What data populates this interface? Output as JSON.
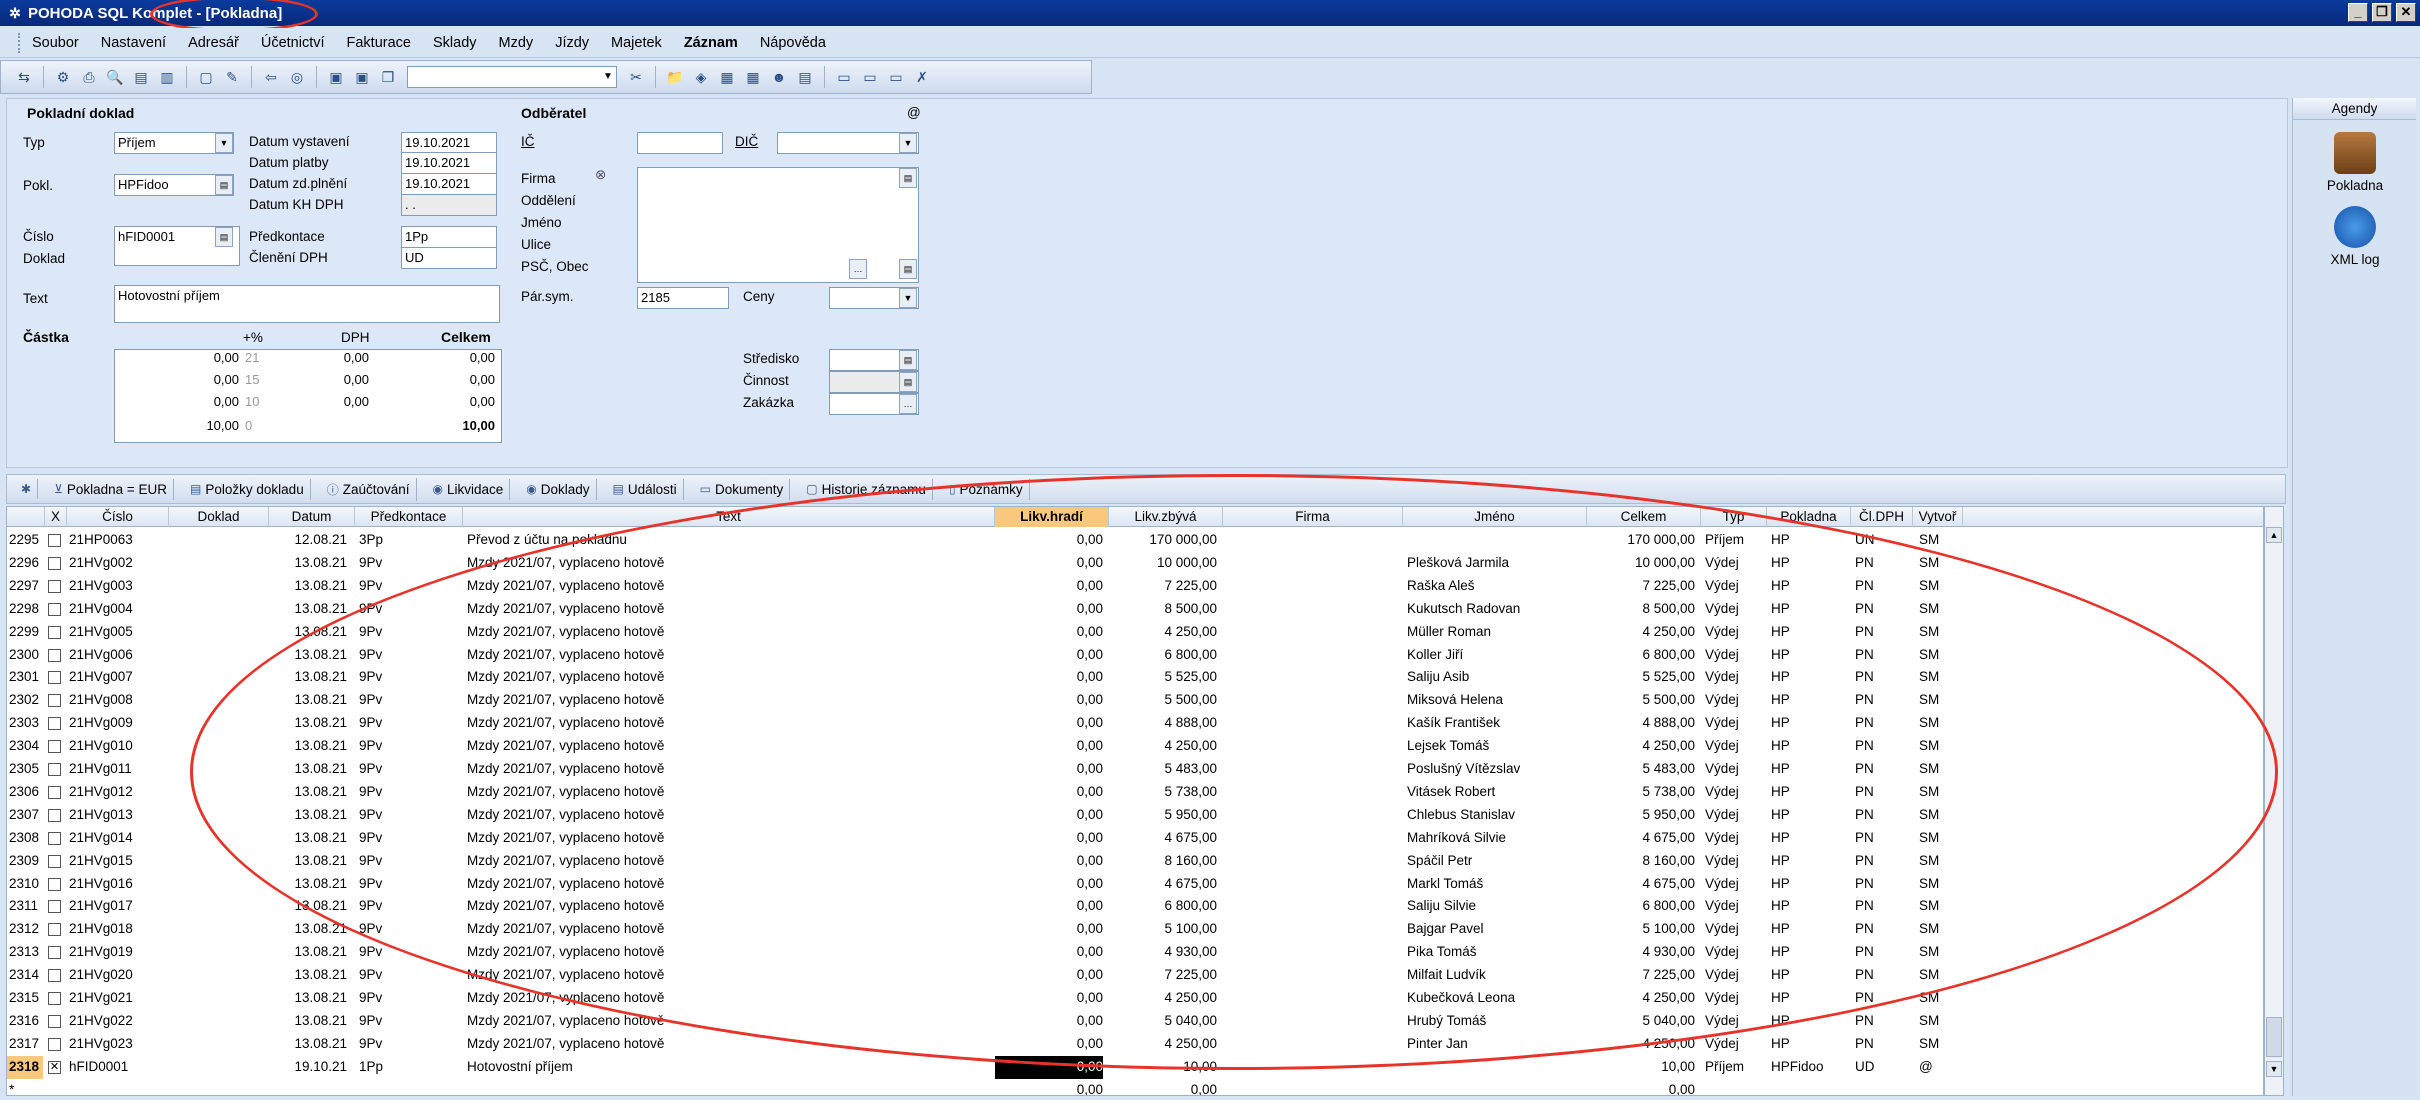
{
  "window": {
    "title": "POHODA SQL Komplet - [Pokladna]"
  },
  "menu": [
    "Soubor",
    "Nastavení",
    "Adresář",
    "Účetnictví",
    "Fakturace",
    "Sklady",
    "Mzdy",
    "Jízdy",
    "Majetek",
    "Záznam",
    "Nápověda"
  ],
  "form": {
    "section_title": "Pokladní doklad",
    "typ_label": "Typ",
    "typ_value": "Příjem",
    "pokl_label": "Pokl.",
    "pokl_value": "HPFidoo",
    "cislo_label": "Číslo",
    "cislo_value": "hFID0001",
    "doklad_label": "Doklad",
    "text_label": "Text",
    "text_value": "Hotovostní příjem",
    "datum_vystaveni_label": "Datum vystavení",
    "datum_vystaveni": "19.10.2021",
    "datum_platby_label": "Datum platby",
    "datum_platby": "19.10.2021",
    "datum_zd_label": "Datum zd.plnění",
    "datum_zd": "19.10.2021",
    "datum_kh_label": "Datum KH DPH",
    "datum_kh": ". .",
    "predkontace_label": "Předkontace",
    "predkontace_value": "1Pp",
    "cleneni_label": "Členění DPH",
    "cleneni_value": "UD",
    "castka_label": "Částka",
    "plus_label": "+%",
    "dph_label": "DPH",
    "celkem_label": "Celkem",
    "amounts": [
      {
        "base": "0,00",
        "rate": "21",
        "dph": "0,00",
        "total": "0,00"
      },
      {
        "base": "0,00",
        "rate": "15",
        "dph": "0,00",
        "total": "0,00"
      },
      {
        "base": "0,00",
        "rate": "10",
        "dph": "0,00",
        "total": "0,00"
      },
      {
        "base": "10,00",
        "rate": "0",
        "dph": "",
        "total": "10,00"
      }
    ]
  },
  "odberatel": {
    "title": "Odběratel",
    "at": "@",
    "ic_label": "IČ",
    "dic_label": "DIČ",
    "firma_label": "Firma",
    "oddeleni_label": "Oddělení",
    "jmeno_label": "Jméno",
    "ulice_label": "Ulice",
    "psc_label": "PSČ, Obec",
    "par_sym_label": "Pár.sym.",
    "par_sym_value": "2185",
    "ceny_label": "Ceny",
    "stredisko_label": "Středisko",
    "cinnost_label": "Činnost",
    "zakazka_label": "Zakázka"
  },
  "agendy": {
    "title": "Agendy",
    "items": [
      {
        "label": "Pokladna"
      },
      {
        "label": "XML log"
      }
    ]
  },
  "tabs": [
    "Pokladna = EUR",
    "Položky dokladu",
    "Zaúčtování",
    "Likvidace",
    "Doklady",
    "Události",
    "Dokumenty",
    "Historie záznamu",
    "Poznámky"
  ],
  "grid": {
    "columns": [
      "X",
      "Číslo",
      "Doklad",
      "Datum",
      "Předkontace",
      "Text",
      "Likv.hradí",
      "Likv.zbývá",
      "Firma",
      "Jméno",
      "Celkem",
      "Typ",
      "Pokladna",
      "Čl.DPH",
      "Vytvoř"
    ],
    "rows": [
      {
        "n": "2295",
        "cislo": "21HP0063",
        "datum": "12.08.21",
        "pk": "3Pp",
        "text": "Převod z účtu na pokladnu",
        "hradi": "0,00",
        "zbyva": "170 000,00",
        "jmeno": "",
        "celkem": "170 000,00",
        "typ": "Příjem",
        "pokl": "HP",
        "cl": "UN",
        "vyt": "SM"
      },
      {
        "n": "2296",
        "cislo": "21HVg002",
        "datum": "13.08.21",
        "pk": "9Pv",
        "text": "Mzdy 2021/07, vyplaceno hotově",
        "hradi": "0,00",
        "zbyva": "10 000,00",
        "jmeno": "Plešková Jarmila",
        "celkem": "10 000,00",
        "typ": "Výdej",
        "pokl": "HP",
        "cl": "PN",
        "vyt": "SM"
      },
      {
        "n": "2297",
        "cislo": "21HVg003",
        "datum": "13.08.21",
        "pk": "9Pv",
        "text": "Mzdy 2021/07, vyplaceno hotově",
        "hradi": "0,00",
        "zbyva": "7 225,00",
        "jmeno": "Raška Aleš",
        "celkem": "7 225,00",
        "typ": "Výdej",
        "pokl": "HP",
        "cl": "PN",
        "vyt": "SM"
      },
      {
        "n": "2298",
        "cislo": "21HVg004",
        "datum": "13.08.21",
        "pk": "9Pv",
        "text": "Mzdy 2021/07, vyplaceno hotově",
        "hradi": "0,00",
        "zbyva": "8 500,00",
        "jmeno": "Kukutsch Radovan",
        "celkem": "8 500,00",
        "typ": "Výdej",
        "pokl": "HP",
        "cl": "PN",
        "vyt": "SM"
      },
      {
        "n": "2299",
        "cislo": "21HVg005",
        "datum": "13.08.21",
        "pk": "9Pv",
        "text": "Mzdy 2021/07, vyplaceno hotově",
        "hradi": "0,00",
        "zbyva": "4 250,00",
        "jmeno": "Müller Roman",
        "celkem": "4 250,00",
        "typ": "Výdej",
        "pokl": "HP",
        "cl": "PN",
        "vyt": "SM"
      },
      {
        "n": "2300",
        "cislo": "21HVg006",
        "datum": "13.08.21",
        "pk": "9Pv",
        "text": "Mzdy 2021/07, vyplaceno hotově",
        "hradi": "0,00",
        "zbyva": "6 800,00",
        "jmeno": "Koller Jiří",
        "celkem": "6 800,00",
        "typ": "Výdej",
        "pokl": "HP",
        "cl": "PN",
        "vyt": "SM"
      },
      {
        "n": "2301",
        "cislo": "21HVg007",
        "datum": "13.08.21",
        "pk": "9Pv",
        "text": "Mzdy 2021/07, vyplaceno hotově",
        "hradi": "0,00",
        "zbyva": "5 525,00",
        "jmeno": "Saliju Asib",
        "celkem": "5 525,00",
        "typ": "Výdej",
        "pokl": "HP",
        "cl": "PN",
        "vyt": "SM"
      },
      {
        "n": "2302",
        "cislo": "21HVg008",
        "datum": "13.08.21",
        "pk": "9Pv",
        "text": "Mzdy 2021/07, vyplaceno hotově",
        "hradi": "0,00",
        "zbyva": "5 500,00",
        "jmeno": "Miksová Helena",
        "celkem": "5 500,00",
        "typ": "Výdej",
        "pokl": "HP",
        "cl": "PN",
        "vyt": "SM"
      },
      {
        "n": "2303",
        "cislo": "21HVg009",
        "datum": "13.08.21",
        "pk": "9Pv",
        "text": "Mzdy 2021/07, vyplaceno hotově",
        "hradi": "0,00",
        "zbyva": "4 888,00",
        "jmeno": "Kašík František",
        "celkem": "4 888,00",
        "typ": "Výdej",
        "pokl": "HP",
        "cl": "PN",
        "vyt": "SM"
      },
      {
        "n": "2304",
        "cislo": "21HVg010",
        "datum": "13.08.21",
        "pk": "9Pv",
        "text": "Mzdy 2021/07, vyplaceno hotově",
        "hradi": "0,00",
        "zbyva": "4 250,00",
        "jmeno": "Lejsek Tomáš",
        "celkem": "4 250,00",
        "typ": "Výdej",
        "pokl": "HP",
        "cl": "PN",
        "vyt": "SM"
      },
      {
        "n": "2305",
        "cislo": "21HVg011",
        "datum": "13.08.21",
        "pk": "9Pv",
        "text": "Mzdy 2021/07, vyplaceno hotově",
        "hradi": "0,00",
        "zbyva": "5 483,00",
        "jmeno": "Poslušný Vítězslav",
        "celkem": "5 483,00",
        "typ": "Výdej",
        "pokl": "HP",
        "cl": "PN",
        "vyt": "SM"
      },
      {
        "n": "2306",
        "cislo": "21HVg012",
        "datum": "13.08.21",
        "pk": "9Pv",
        "text": "Mzdy 2021/07, vyplaceno hotově",
        "hradi": "0,00",
        "zbyva": "5 738,00",
        "jmeno": "Vitásek Robert",
        "celkem": "5 738,00",
        "typ": "Výdej",
        "pokl": "HP",
        "cl": "PN",
        "vyt": "SM"
      },
      {
        "n": "2307",
        "cislo": "21HVg013",
        "datum": "13.08.21",
        "pk": "9Pv",
        "text": "Mzdy 2021/07, vyplaceno hotově",
        "hradi": "0,00",
        "zbyva": "5 950,00",
        "jmeno": "Chlebus Stanislav",
        "celkem": "5 950,00",
        "typ": "Výdej",
        "pokl": "HP",
        "cl": "PN",
        "vyt": "SM"
      },
      {
        "n": "2308",
        "cislo": "21HVg014",
        "datum": "13.08.21",
        "pk": "9Pv",
        "text": "Mzdy 2021/07, vyplaceno hotově",
        "hradi": "0,00",
        "zbyva": "4 675,00",
        "jmeno": "Mahríková Silvie",
        "celkem": "4 675,00",
        "typ": "Výdej",
        "pokl": "HP",
        "cl": "PN",
        "vyt": "SM"
      },
      {
        "n": "2309",
        "cislo": "21HVg015",
        "datum": "13.08.21",
        "pk": "9Pv",
        "text": "Mzdy 2021/07, vyplaceno hotově",
        "hradi": "0,00",
        "zbyva": "8 160,00",
        "jmeno": "Spáčil Petr",
        "celkem": "8 160,00",
        "typ": "Výdej",
        "pokl": "HP",
        "cl": "PN",
        "vyt": "SM"
      },
      {
        "n": "2310",
        "cislo": "21HVg016",
        "datum": "13.08.21",
        "pk": "9Pv",
        "text": "Mzdy 2021/07, vyplaceno hotově",
        "hradi": "0,00",
        "zbyva": "4 675,00",
        "jmeno": "Markl Tomáš",
        "celkem": "4 675,00",
        "typ": "Výdej",
        "pokl": "HP",
        "cl": "PN",
        "vyt": "SM"
      },
      {
        "n": "2311",
        "cislo": "21HVg017",
        "datum": "13.08.21",
        "pk": "9Pv",
        "text": "Mzdy 2021/07, vyplaceno hotově",
        "hradi": "0,00",
        "zbyva": "6 800,00",
        "jmeno": "Saliju Silvie",
        "celkem": "6 800,00",
        "typ": "Výdej",
        "pokl": "HP",
        "cl": "PN",
        "vyt": "SM"
      },
      {
        "n": "2312",
        "cislo": "21HVg018",
        "datum": "13.08.21",
        "pk": "9Pv",
        "text": "Mzdy 2021/07, vyplaceno hotově",
        "hradi": "0,00",
        "zbyva": "5 100,00",
        "jmeno": "Bajgar Pavel",
        "celkem": "5 100,00",
        "typ": "Výdej",
        "pokl": "HP",
        "cl": "PN",
        "vyt": "SM"
      },
      {
        "n": "2313",
        "cislo": "21HVg019",
        "datum": "13.08.21",
        "pk": "9Pv",
        "text": "Mzdy 2021/07, vyplaceno hotově",
        "hradi": "0,00",
        "zbyva": "4 930,00",
        "jmeno": "Pika Tomáš",
        "celkem": "4 930,00",
        "typ": "Výdej",
        "pokl": "HP",
        "cl": "PN",
        "vyt": "SM"
      },
      {
        "n": "2314",
        "cislo": "21HVg020",
        "datum": "13.08.21",
        "pk": "9Pv",
        "text": "Mzdy 2021/07, vyplaceno hotově",
        "hradi": "0,00",
        "zbyva": "7 225,00",
        "jmeno": "Milfait Ludvík",
        "celkem": "7 225,00",
        "typ": "Výdej",
        "pokl": "HP",
        "cl": "PN",
        "vyt": "SM"
      },
      {
        "n": "2315",
        "cislo": "21HVg021",
        "datum": "13.08.21",
        "pk": "9Pv",
        "text": "Mzdy 2021/07, vyplaceno hotově",
        "hradi": "0,00",
        "zbyva": "4 250,00",
        "jmeno": "Kubečková Leona",
        "celkem": "4 250,00",
        "typ": "Výdej",
        "pokl": "HP",
        "cl": "PN",
        "vyt": "SM"
      },
      {
        "n": "2316",
        "cislo": "21HVg022",
        "datum": "13.08.21",
        "pk": "9Pv",
        "text": "Mzdy 2021/07, vyplaceno hotově",
        "hradi": "0,00",
        "zbyva": "5 040,00",
        "jmeno": "Hrubý Tomáš",
        "celkem": "5 040,00",
        "typ": "Výdej",
        "pokl": "HP",
        "cl": "PN",
        "vyt": "SM"
      },
      {
        "n": "2317",
        "cislo": "21HVg023",
        "datum": "13.08.21",
        "pk": "9Pv",
        "text": "Mzdy 2021/07, vyplaceno hotově",
        "hradi": "0,00",
        "zbyva": "4 250,00",
        "jmeno": "Pinter Jan",
        "celkem": "4 250,00",
        "typ": "Výdej",
        "pokl": "HP",
        "cl": "PN",
        "vyt": "SM"
      },
      {
        "n": "2318",
        "cislo": "hFID0001",
        "datum": "19.10.21",
        "pk": "1Pp",
        "text": "Hotovostní příjem",
        "hradi": "0,00",
        "zbyva": "10,00",
        "jmeno": "",
        "celkem": "10,00",
        "typ": "Příjem",
        "pokl": "HPFidoo",
        "cl": "UD",
        "vyt": "@",
        "current": true
      },
      {
        "n": "*",
        "cislo": "",
        "datum": "",
        "pk": "",
        "text": "",
        "hradi": "0,00",
        "zbyva": "0,00",
        "jmeno": "",
        "celkem": "0,00",
        "typ": "",
        "pokl": "",
        "cl": "",
        "vyt": ""
      }
    ]
  }
}
